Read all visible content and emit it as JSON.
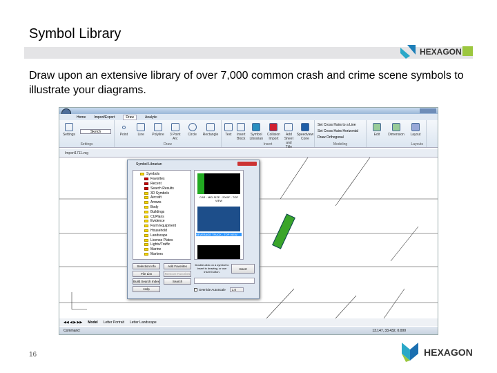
{
  "slide": {
    "title": "Symbol Library",
    "body": "Draw upon an extensive library of over 7,000 common crash and crime scene symbols to illustrate your diagrams.",
    "page_number": "16",
    "logo_text": "HEXAGON"
  },
  "app": {
    "tabs": [
      "Home",
      "Import/Export",
      "Draw",
      "Analytic"
    ],
    "active_tab": "Draw",
    "settings_group": {
      "label": "Settings",
      "layer_value": "Sketch",
      "button": "Settings"
    },
    "draw_group": {
      "label": "Draw",
      "buttons": [
        "Point",
        "Line",
        "Polyline",
        "3 Point Arc",
        "Circle",
        "Rectangle"
      ]
    },
    "insert_group": {
      "label": "Insert",
      "buttons": [
        "Text",
        "Insert Block",
        "Symbol Librarian",
        "Collision Import",
        "Add Sheet and Title Block",
        "Speedview Cone"
      ]
    },
    "modeling_group": {
      "label": "Modeling",
      "items": [
        "Set Cross Hairs to a Line",
        "Set Cross Hairs Horizontal",
        "Draw Orthogonal"
      ]
    },
    "other_buttons": [
      "Edit",
      "Dimension",
      "Layout"
    ],
    "layouts_label": "Layouts",
    "document_tab": "Import1711.vsg",
    "sheet_tabs": [
      "Model",
      "Letter Portrait",
      "Letter Landscape"
    ],
    "status_text": "Command:",
    "coordinates": "13.147, 33.432, 0.000"
  },
  "dialog": {
    "title": "Symbol Librarian",
    "tree": [
      {
        "label": "Symbols",
        "color": "yellow"
      },
      {
        "label": "Favorites",
        "color": "red"
      },
      {
        "label": "Recent",
        "color": "red"
      },
      {
        "label": "Search Results",
        "color": "red"
      },
      {
        "label": "3D Symbols",
        "color": "yellow"
      },
      {
        "label": "Aircraft",
        "color": "yellow"
      },
      {
        "label": "Arrows",
        "color": "yellow"
      },
      {
        "label": "Body",
        "color": "yellow"
      },
      {
        "label": "Buildings",
        "color": "yellow"
      },
      {
        "label": "CUPlans",
        "color": "yellow"
      },
      {
        "label": "Evidence",
        "color": "yellow"
      },
      {
        "label": "Farm Equipment",
        "color": "yellow"
      },
      {
        "label": "Household",
        "color": "yellow"
      },
      {
        "label": "Landscape",
        "color": "yellow"
      },
      {
        "label": "License Plates",
        "color": "yellow"
      },
      {
        "label": "Lights/Traffic",
        "color": "yellow"
      },
      {
        "label": "Marine",
        "color": "yellow"
      },
      {
        "label": "Markers",
        "color": "yellow"
      }
    ],
    "preview_items": [
      "CAR - MID-SIZE - 2000F - TOP VIEW",
      "BEVERAGE TRUCK - TOP VIEW"
    ],
    "buttons": {
      "selection_info": "Selection Info",
      "add_favorites": "Add Favorites",
      "file_list": "File List",
      "remove_favorites": "Remove Favorites",
      "build_search_index": "Build Search Index",
      "search": "Search",
      "help": "Help",
      "insert": "Insert"
    },
    "hint": "Double-click on a symbol to insert in drawing, or use Insert button.",
    "override_label": "Override AutoScale",
    "scale_value": "1.0"
  }
}
